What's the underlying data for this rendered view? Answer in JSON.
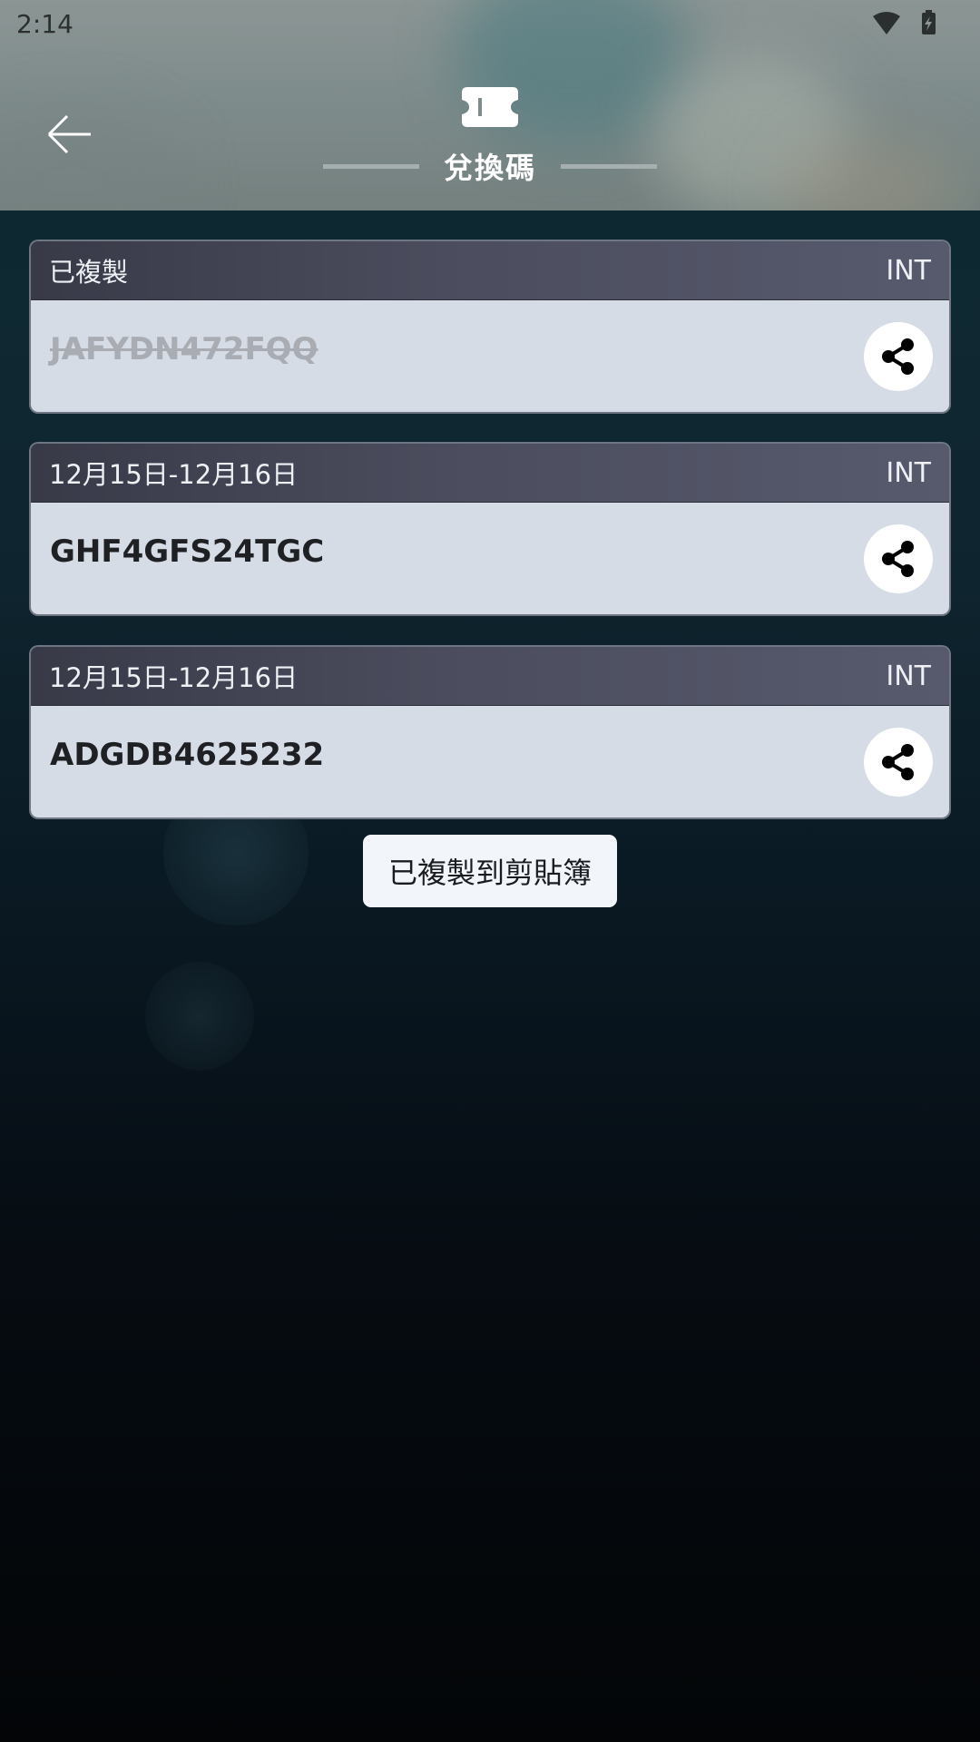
{
  "status_bar": {
    "time": "2:14",
    "wifi_icon": "wifi-icon",
    "battery_icon": "battery-charging-icon"
  },
  "header": {
    "back_icon": "back-arrow-icon",
    "title_icon": "ticket-icon",
    "title": "兌換碼"
  },
  "codes": [
    {
      "label": "已複製",
      "region": "INT",
      "code": "JAFYDN472FQQ",
      "used": true,
      "share_icon": "share-icon"
    },
    {
      "label": "12月15日-12月16日",
      "region": "INT",
      "code": "GHF4GFS24TGC",
      "used": false,
      "share_icon": "share-icon"
    },
    {
      "label": "12月15日-12月16日",
      "region": "INT",
      "code": "ADGDB4625232",
      "used": false,
      "share_icon": "share-icon"
    }
  ],
  "toast": {
    "text": "已複製到剪貼簿"
  },
  "colors": {
    "card_header": "#4b4d5e",
    "card_body": "#d5dce6",
    "used_code": "#a9adb3",
    "toast_bg": "#f2f6fb"
  }
}
